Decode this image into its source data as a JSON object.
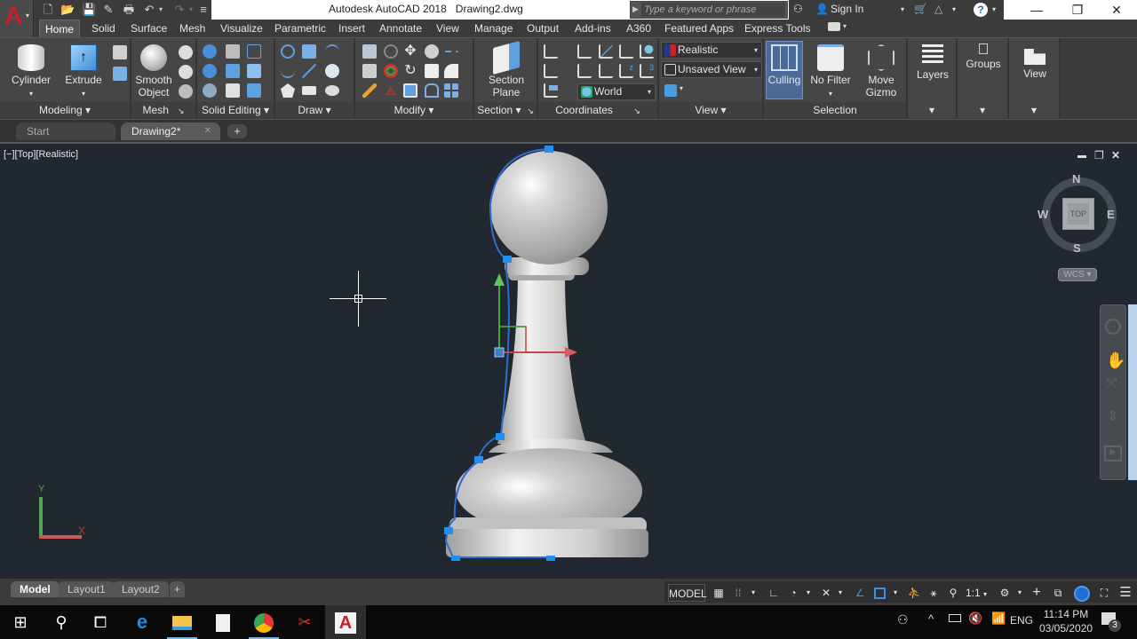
{
  "window": {
    "app_title": "Autodesk AutoCAD 2018",
    "doc_title": "Drawing2.dwg",
    "search_placeholder": "Type a keyword or phrase",
    "sign_in": "Sign In",
    "minimize": "—",
    "restore": "❐",
    "close": "✕"
  },
  "app_button": {
    "glyph": "A",
    "caret": "▾"
  },
  "quick_access": [
    "new-icon",
    "open-icon",
    "save-icon",
    "save-as-icon",
    "plot-icon",
    "undo-icon",
    "redo-icon",
    "customize-icon"
  ],
  "ribbon_tabs": [
    "Home",
    "Solid",
    "Surface",
    "Mesh",
    "Visualize",
    "Parametric",
    "Insert",
    "Annotate",
    "View",
    "Manage",
    "Output",
    "Add-ins",
    "A360",
    "Featured Apps",
    "Express Tools"
  ],
  "active_ribbon_tab": "Home",
  "panels": {
    "modeling": {
      "label": "Modeling ▾",
      "buttons": [
        "Cylinder",
        "Extrude"
      ]
    },
    "mesh": {
      "label": "Mesh",
      "corner": "↘",
      "buttons": [
        "Smooth Object"
      ]
    },
    "solid_editing": {
      "label": "Solid Editing ▾"
    },
    "draw": {
      "label": "Draw ▾"
    },
    "modify": {
      "label": "Modify ▾"
    },
    "section": {
      "label": "Section ▾",
      "corner": "↘",
      "buttons": [
        "Section Plane"
      ]
    },
    "coordinates": {
      "label": "Coordinates",
      "corner": "↘",
      "ucs_value": "World"
    },
    "view": {
      "label": "View ▾",
      "visual_style": "Realistic",
      "named_view": "Unsaved View"
    },
    "selection": {
      "label": "Selection",
      "buttons": [
        "Culling",
        "No Filter",
        "Move Gizmo"
      ]
    },
    "layers": {
      "label": "Layers"
    },
    "groups": {
      "label": "Groups"
    },
    "view2": {
      "label": "View"
    }
  },
  "file_tabs": [
    {
      "label": "Start",
      "active": false
    },
    {
      "label": "Drawing2*",
      "active": true,
      "close": "✕"
    }
  ],
  "new_tab": "+",
  "viewport": {
    "label": "[−][Top][Realistic]",
    "controls": {
      "min": "▬",
      "restore": "❐",
      "close": "✕"
    },
    "viewcube": {
      "N": "N",
      "S": "S",
      "E": "E",
      "W": "W",
      "face": "TOP",
      "wcs": "WCS ▾"
    },
    "ucs_icon": {
      "x": "X",
      "y": "Y"
    }
  },
  "layout_tabs": [
    "Model",
    "Layout1",
    "Layout2"
  ],
  "active_layout": "Model",
  "add_layout": "+",
  "status": {
    "model": "MODEL",
    "scale": "1:1",
    "items": [
      "grid",
      "snap",
      "ortho",
      "polar",
      "isodraft",
      "osnap-tracking",
      "osnap",
      "annotation-visibility",
      "auto-scale",
      "annotation-scale",
      "workspace",
      "annotation-monitor",
      "units",
      "quick-properties",
      "hardware-accel",
      "clean-screen",
      "customize"
    ]
  },
  "taskbar": {
    "apps": [
      "start",
      "search",
      "task-view",
      "edge",
      "file-explorer",
      "calculator",
      "chrome",
      "snipping-tool",
      "autocad"
    ],
    "tray": {
      "lang": "ENG",
      "time": "11:14 PM",
      "date": "03/05/2020",
      "notifications": "3"
    }
  },
  "colors": {
    "viewport_bg": "#212830",
    "ribbon_bg": "#3b3b3b",
    "accent_blue": "#1f8ff0",
    "autocad_red": "#c8202a"
  }
}
